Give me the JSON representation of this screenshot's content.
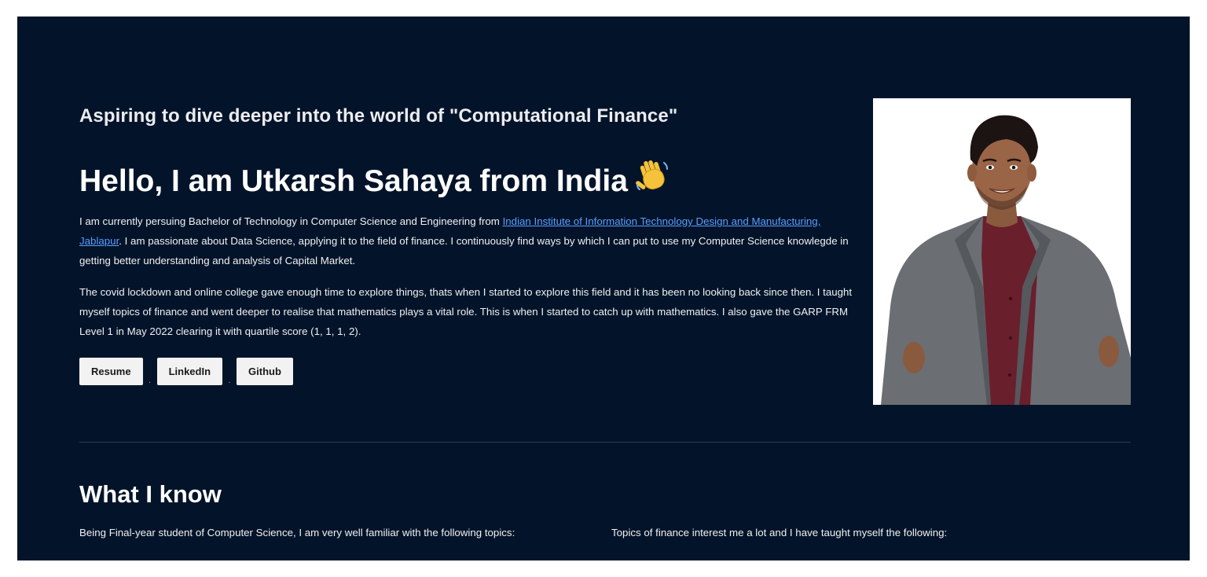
{
  "hero": {
    "tagline": "Aspiring to dive deeper into the world of \"Computational Finance\"",
    "headline": "Hello, I am Utkarsh Sahaya from India",
    "wave_icon": "waving-hand-icon",
    "para1_before": "I am currently persuing Bachelor of Technology in Computer Science and Engineering from ",
    "para1_link": "Indian Institute of Information Technology Design and Manufacturing, Jablapur",
    "para1_after": ". I am passionate about Data Science, applying it to the field of finance. I continuously find ways by which I can put to use my Computer Science knowlegde in getting better understanding and analysis of Capital Market.",
    "para2": "The covid lockdown and online college gave enough time to explore things, thats when I started to explore this field and it has been no looking back since then. I taught myself topics of finance and went deeper to realise that mathematics plays a vital role. This is when I started to catch up with mathematics. I also gave the GARP FRM Level 1 in May 2022 clearing it with quartile score (1, 1, 1, 2).",
    "buttons": {
      "resume": "Resume",
      "linkedin": "LinkedIn",
      "github": "Github"
    },
    "separator": "."
  },
  "skills": {
    "title": "What I know",
    "left_text": "Being Final-year student of Computer Science, I am very well familiar with the following topics:",
    "right_text": "Topics of finance interest me a lot and I have taught myself the following:"
  },
  "colors": {
    "background": "#03142a",
    "link": "#5b9cff",
    "button_bg": "#f2f2f2"
  }
}
